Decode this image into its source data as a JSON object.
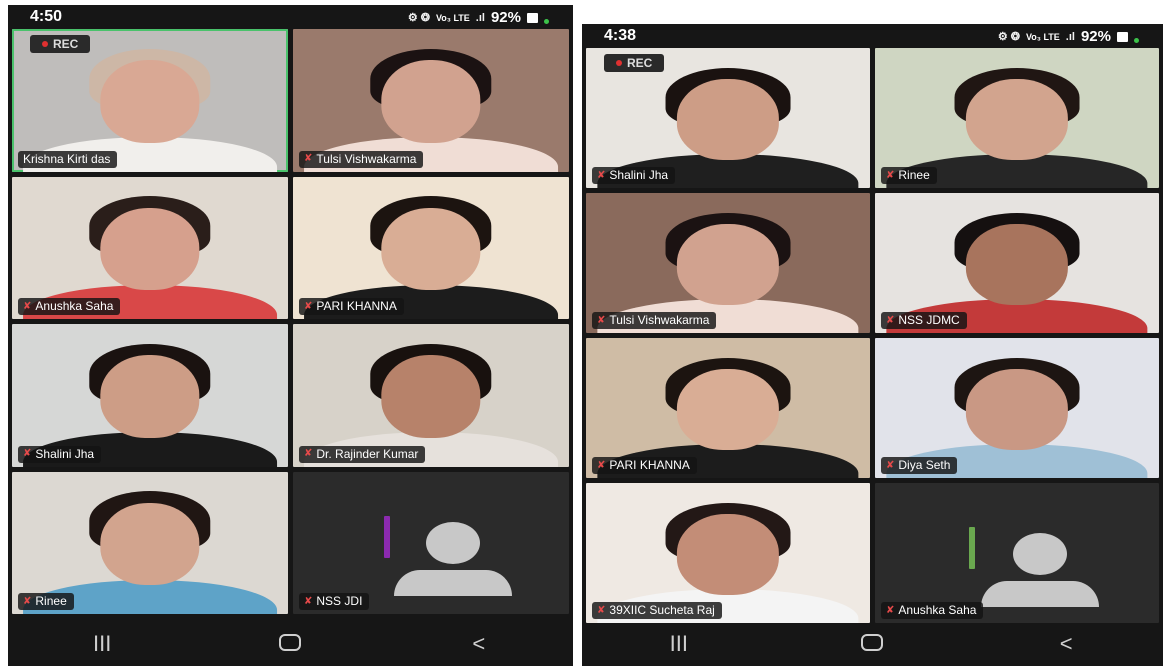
{
  "left": {
    "status": {
      "time": "4:50",
      "icons": "⚙ ❂",
      "network": "Vo₃ LTE",
      "lte": "LTE",
      "battery": "92%"
    },
    "rec_label": "REC",
    "tiles": [
      {
        "name": "Krishna Kirti das",
        "muted": false,
        "bg": "#bfbdbb",
        "skin": "#d9a894",
        "shirt": "#f1efec",
        "hair": "#cdb7a6",
        "active": true
      },
      {
        "name": "Tulsi Vishwakarma",
        "muted": true,
        "bg": "#9a7a6c",
        "skin": "#d1a28f",
        "shirt": "#f0ddd5",
        "hair": "#1b1212"
      },
      {
        "name": "Anushka Saha",
        "muted": true,
        "bg": "#e0d9d0",
        "skin": "#d6a08d",
        "shirt": "#d94848",
        "hair": "#2a1e1a"
      },
      {
        "name": "PARI KHANNA",
        "muted": true,
        "bg": "#efe3d2",
        "skin": "#d9ad95",
        "shirt": "#1c1c1c",
        "hair": "#1c1410"
      },
      {
        "name": "Shalini Jha",
        "muted": true,
        "bg": "#d6d7d6",
        "skin": "#cd9d86",
        "shirt": "#1a1a1a",
        "hair": "#1a1210"
      },
      {
        "name": "Dr. Rajinder Kumar",
        "muted": true,
        "bg": "#d7d2c9",
        "skin": "#b7826a",
        "shirt": "#e6e1dc",
        "hair": "#18110e"
      },
      {
        "name": "Rinee",
        "muted": true,
        "bg": "#dcd8d2",
        "skin": "#d2a48e",
        "shirt": "#5ea3c8",
        "hair": "#201613"
      },
      {
        "name": "NSS JDI",
        "muted": true,
        "avatar": true,
        "bar": "#8c2ab0"
      }
    ],
    "nav": [
      "III",
      "○",
      "<"
    ]
  },
  "right": {
    "status": {
      "time": "4:38",
      "icons": "⚙ ❂",
      "network": "Vo₃ LTE",
      "lte": "LTE",
      "battery": "92%"
    },
    "rec_label": "REC",
    "tiles": [
      {
        "name": "Shalini Jha",
        "muted": true,
        "bg": "#e8e5e0",
        "skin": "#cd9d86",
        "shirt": "#1f1f1f",
        "hair": "#1a1210"
      },
      {
        "name": "Rinee",
        "muted": true,
        "bg": "#cfd6c2",
        "skin": "#d2a48e",
        "shirt": "#262626",
        "hair": "#201613"
      },
      {
        "name": "Tulsi Vishwakarma",
        "muted": true,
        "bg": "#8a6a5c",
        "skin": "#d1a28f",
        "shirt": "#f0ddd5",
        "hair": "#1b1212"
      },
      {
        "name": "NSS JDMC",
        "muted": true,
        "bg": "#e6e3e0",
        "skin": "#a8745d",
        "shirt": "#c33a3a",
        "hair": "#151010"
      },
      {
        "name": "PARI KHANNA",
        "muted": true,
        "bg": "#cfbca5",
        "skin": "#d9ad95",
        "shirt": "#1c1c1c",
        "hair": "#1c1410"
      },
      {
        "name": "Diya Seth",
        "muted": true,
        "bg": "#e1e3ea",
        "skin": "#c99884",
        "shirt": "#9fc0d6",
        "hair": "#1d1512"
      },
      {
        "name": "39XIIC Sucheta Raj",
        "muted": true,
        "bg": "#efe9e3",
        "skin": "#c38d77",
        "shirt": "#f4f4f4",
        "hair": "#231816"
      },
      {
        "name": "Anushka Saha",
        "muted": true,
        "avatar": true,
        "bar": "#6aa84f"
      }
    ],
    "nav": [
      "III",
      "○",
      "<"
    ]
  }
}
